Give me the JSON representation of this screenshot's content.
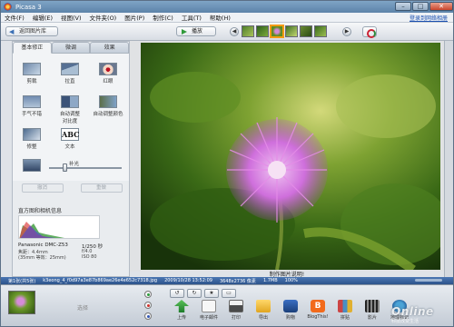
{
  "window": {
    "title": "Picasa 3",
    "min": "–",
    "max": "□",
    "close": "✕"
  },
  "menu": [
    "文件(F)",
    "编辑(E)",
    "视图(V)",
    "文件夹(O)",
    "图片(P)",
    "制作(C)",
    "工具(T)",
    "帮助(H)"
  ],
  "signin": "登录到网络相册",
  "toolbar": {
    "back_label": "返回图片库",
    "play_label": "播放",
    "prev": "◀",
    "next": "▶"
  },
  "tabs": [
    "基本修正",
    "微调",
    "效果"
  ],
  "tools": [
    {
      "label": "剪裁",
      "icon": "crop-icon"
    },
    {
      "label": "拉直",
      "icon": "straighten-icon"
    },
    {
      "label": "红眼",
      "icon": "redeye-icon"
    },
    {
      "label": "手气不错",
      "icon": "lucky-icon"
    },
    {
      "label": "自动调整\n对比度",
      "icon": "auto-contrast-icon"
    },
    {
      "label": "自动调整颜色",
      "icon": "auto-color-icon"
    },
    {
      "label": "修整",
      "icon": "retouch-icon"
    },
    {
      "label": "文本",
      "icon": "text-icon",
      "glyph": "ABC"
    },
    {
      "label": "",
      "icon": "fill-light-icon"
    }
  ],
  "slider_label": "补光",
  "undo_label": "撤消",
  "redo_label": "重做",
  "camera": {
    "section_title": "直方图和相机信息",
    "model": "Panasonic DMC-Z53",
    "line1": "焦距：4.4mm",
    "line2": "(35mm 等效：25mm)",
    "shutter": "1/250 秒",
    "aperture": "f/4.0",
    "iso": "ISO 80"
  },
  "caption": "制作图片说明!",
  "status": {
    "index": "第1张(共5张)",
    "filename": "k3eong_4_f0d97a3e87b869ae26e4e652c7318.jpg",
    "date": "2009/10/28 13:52:09",
    "dimensions": "3648x2736 像素",
    "size": "1.7MB",
    "zoom": "100%"
  },
  "tray": {
    "label": "选择",
    "mini_tools": [
      "↺",
      "↻",
      "★",
      "▭"
    ],
    "actions": [
      {
        "label": "上传",
        "icon": "upload-icon"
      },
      {
        "label": "电子邮件",
        "icon": "email-icon"
      },
      {
        "label": "打印",
        "icon": "print-icon"
      },
      {
        "label": "导出",
        "icon": "export-icon"
      },
      {
        "label": "购物",
        "icon": "shop-icon"
      },
      {
        "label": "BlogThis!",
        "icon": "blogger-icon",
        "glyph": "B"
      },
      {
        "label": "拼贴",
        "icon": "collage-icon"
      },
      {
        "label": "影片",
        "icon": "movie-icon"
      },
      {
        "label": "地理标记",
        "icon": "geotag-icon"
      }
    ]
  },
  "colors": {
    "titlebar": "#5c83a9",
    "statusbar": "#2d548c",
    "accent": "#f39b14",
    "flower": "#c86bd8"
  },
  "watermark": {
    "main": "Online",
    "sub": "科技改变生活"
  }
}
